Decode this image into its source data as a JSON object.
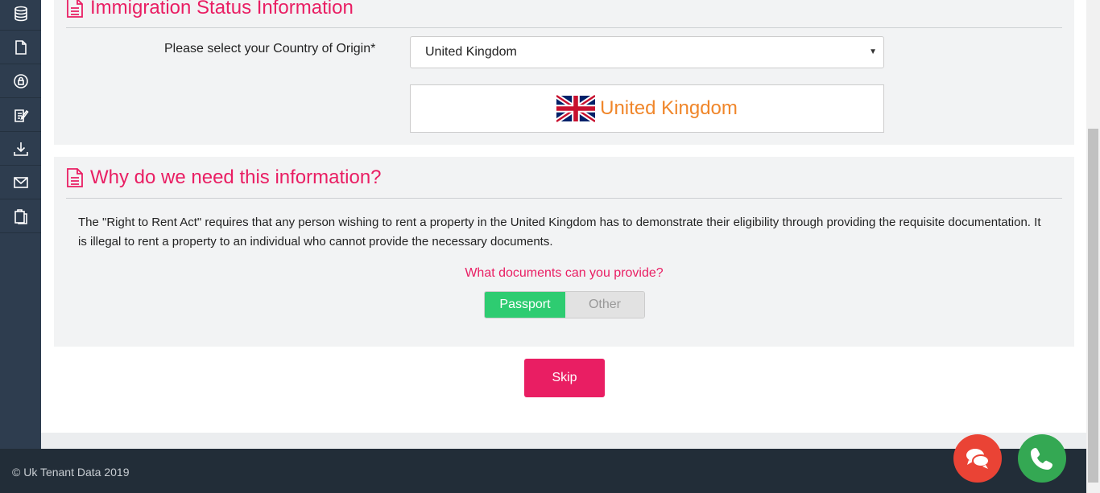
{
  "sidebar": {
    "icons": [
      "database-icon",
      "document-icon",
      "lock-icon",
      "edit-icon",
      "download-icon",
      "mail-icon",
      "clipboard-icon"
    ]
  },
  "immigration": {
    "title": "Immigration Status Information",
    "country_label": "Please select your Country of Origin*",
    "country_value": "United Kingdom",
    "country_display": "United Kingdom"
  },
  "why": {
    "title": "Why do we need this information?",
    "paragraph": "The \"Right to Rent Act\" requires that any person wishing to rent a property in the United Kingdom has to demonstrate their eligibility through providing the requisite documentation. It is illegal to rent a property to an individual who cannot provide the necessary documents.",
    "question": "What documents can you provide?",
    "options": [
      "Passport",
      "Other"
    ],
    "selected": "Passport"
  },
  "actions": {
    "skip_label": "Skip"
  },
  "footer": {
    "copyright": "© Uk Tenant Data 2019"
  },
  "colors": {
    "accent": "#e91e63",
    "orange": "#f0862a",
    "green": "#2ecc71",
    "sidebar": "#2e3d4f",
    "footer": "#222d38"
  }
}
